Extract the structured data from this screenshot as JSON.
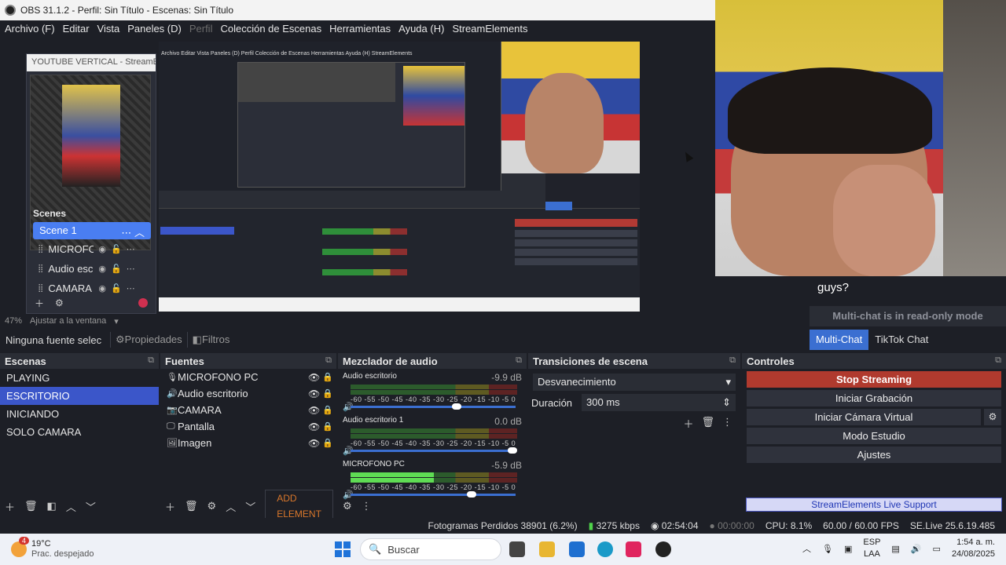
{
  "window": {
    "title": "OBS 31.1.2 - Perfil: Sin Título - Escenas: Sin Título"
  },
  "menu": {
    "items": [
      "Archivo (F)",
      "Editar",
      "Vista",
      "Paneles (D)",
      "Perfil",
      "Colección de Escenas",
      "Herramientas",
      "Ayuda (H)",
      "StreamElements"
    ],
    "disabled_index": 4
  },
  "vertical_dock": {
    "title": "YOUTUBE VERTICAL - StreamEl...",
    "scenes_header": "Scenes",
    "active_scene": "Scene 1",
    "sources": [
      {
        "name": "MICROFONO"
      },
      {
        "name": "Audio esc"
      },
      {
        "name": "CAMARA"
      }
    ]
  },
  "preview": {
    "zoom": "47%",
    "fit_label": "Ajustar a la ventana",
    "nested_menu": "Archivo  Editar  Vista  Paneles (D)  Perfil  Colección de Escenas  Herramientas  Ayuda (H)  StreamElements"
  },
  "chat": {
    "message": "guys?",
    "readonly": "Multi-chat is in read-only mode",
    "tabs": [
      "Multi-Chat",
      "TikTok Chat"
    ],
    "active_tab": "Multi-Chat"
  },
  "source_toolbar": {
    "no_source": "Ninguna fuente selec",
    "properties": "Propiedades",
    "filters": "Filtros"
  },
  "scenes": {
    "header": "Escenas",
    "items": [
      "PLAYING",
      "ESCRITORIO",
      "INICIANDO",
      "SOLO CAMARA"
    ],
    "selected": "ESCRITORIO"
  },
  "sources": {
    "header": "Fuentes",
    "items": [
      {
        "name": "MICROFONO PC",
        "icon": "microphone-icon",
        "glyph": "🎙"
      },
      {
        "name": "Audio escritorio",
        "icon": "speaker-icon",
        "glyph": "🔊"
      },
      {
        "name": "CAMARA",
        "icon": "camera-icon",
        "glyph": "📷"
      },
      {
        "name": "Pantalla",
        "icon": "monitor-icon",
        "glyph": "🖵"
      },
      {
        "name": "Imagen",
        "icon": "image-icon",
        "glyph": "🖼"
      }
    ],
    "add_element": "ADD ELEMENT"
  },
  "mixer": {
    "header": "Mezclador de audio",
    "scale": "-60 -55 -50 -45 -40 -35 -30 -25 -20 -15 -10 -5 0",
    "channels": [
      {
        "name": "Audio escritorio",
        "db": "-9.9 dB",
        "level": 0.0,
        "volume": 0.66
      },
      {
        "name": "Audio escritorio 1",
        "db": "0.0 dB",
        "level": 0.0,
        "volume": 1.0
      },
      {
        "name": "MICROFONO PC",
        "db": "-5.9 dB",
        "level": 0.5,
        "volume": 0.75
      }
    ]
  },
  "transitions": {
    "header": "Transiciones de escena",
    "selected": "Desvanecimiento",
    "duration_label": "Duración",
    "duration_value": "300 ms"
  },
  "controls": {
    "header": "Controles",
    "stream": "Stop Streaming",
    "record": "Iniciar Grabación",
    "virtual_cam": "Iniciar Cámara Virtual",
    "studio": "Modo Estudio",
    "settings": "Ajustes",
    "se_support": "StreamElements Live Support"
  },
  "status": {
    "dropped": "Fotogramas Perdidos 38901 (6.2%)",
    "bitrate": "3275 kbps",
    "stream_time": "02:54:04",
    "rec_time": "00:00:00",
    "cpu": "CPU: 8.1%",
    "fps": "60.00 / 60.00 FPS",
    "version": "SE.Live 25.6.19.485"
  },
  "taskbar": {
    "temp": "19°C",
    "weather": "Prac. despejado",
    "badge": "4",
    "search": "Buscar",
    "lang1": "ESP",
    "lang2": "LAA",
    "time": "1:54 a. m.",
    "date": "24/08/2025"
  },
  "colors": {
    "accent": "#3b56c9",
    "stream_red": "#b03a2e",
    "bg": "#1d1f26"
  }
}
